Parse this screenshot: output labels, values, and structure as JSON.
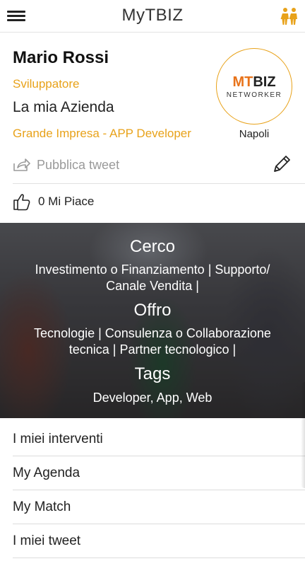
{
  "header": {
    "title": "MyTBIZ",
    "menu_icon": "hamburger-icon",
    "people_icon": "people-icon"
  },
  "profile": {
    "name": "Mario Rossi",
    "role": "Sviluppatore",
    "company": "La mia Azienda",
    "company_type": "Grande Impresa - APP Developer",
    "logo": {
      "prefix": "MT",
      "brand": "BIZ",
      "subtitle": "NETWORKER"
    },
    "city": "Napoli"
  },
  "actions": {
    "tweet_label": "Pubblica tweet",
    "likes_label": "0 Mi Piace"
  },
  "banner": {
    "cerco_title": "Cerco",
    "cerco_text": "Investimento o Finanziamento | Supporto/ Canale Vendita |",
    "offro_title": "Offro",
    "offro_text": "Tecnologie | Consulenza o Collaborazione tecnica | Partner tecnologico |",
    "tags_title": "Tags",
    "tags_text": "Developer, App, Web"
  },
  "menu": [
    {
      "label": "I miei interventi"
    },
    {
      "label": "My Agenda"
    },
    {
      "label": "My Match"
    },
    {
      "label": "I miei tweet"
    }
  ],
  "colors": {
    "accent": "#e8a21a",
    "brand_orange": "#e8731a"
  }
}
